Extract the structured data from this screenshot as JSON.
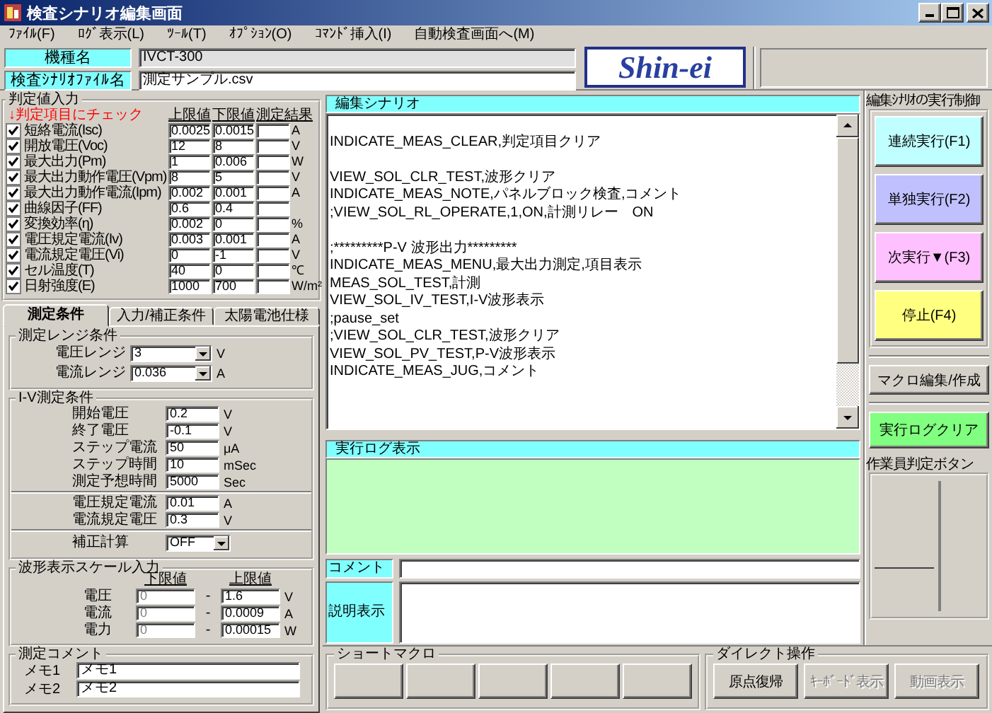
{
  "window": {
    "title": "検査シナリオ編集画面"
  },
  "menu": [
    {
      "label": "ﾌｧｲﾙ(F)"
    },
    {
      "label": "ﾛｸﾞ表示(L)"
    },
    {
      "label": "ﾂｰﾙ(T)"
    },
    {
      "label": "ｵﾌﾟｼｮﾝ(O)"
    },
    {
      "label": "ｺﾏﾝﾄﾞ挿入(I)"
    },
    {
      "label": "自動検査画面へ(M)"
    }
  ],
  "model": {
    "label": "機種名",
    "value": "IVCT-300",
    "readonly": true
  },
  "scenario_file": {
    "label": "検査ｼﾅﾘｵﾌｧｲﾙ名",
    "value": "測定サンプル.csv",
    "readonly": false
  },
  "logo": {
    "text": "Shin-ei"
  },
  "judgement": {
    "title": "判定値入力",
    "hint": "↓判定項目にチェック",
    "columns": [
      "上限値",
      "下限値",
      "測定結果"
    ],
    "rows": [
      {
        "name": "短絡電流(Isc)",
        "checked": true,
        "upper": "0.0025",
        "lower": "0.0015",
        "unit": "A"
      },
      {
        "name": "開放電圧(Voc)",
        "checked": true,
        "upper": "12",
        "lower": "8",
        "unit": "V"
      },
      {
        "name": "最大出力(Pm)",
        "checked": true,
        "upper": "1",
        "lower": "0.006",
        "unit": "W"
      },
      {
        "name": "最大出力動作電圧(Vpm)",
        "checked": true,
        "upper": "8",
        "lower": "5",
        "unit": "V"
      },
      {
        "name": "最大出力動作電流(Ipm)",
        "checked": true,
        "upper": "0.002",
        "lower": "0.001",
        "unit": "A"
      },
      {
        "name": "曲線因子(FF)",
        "checked": true,
        "upper": "0.6",
        "lower": "0.4"
      },
      {
        "name": "変換効率(η)",
        "checked": true,
        "upper": "0.002",
        "lower": "0",
        "unit": "%"
      },
      {
        "name": "電圧規定電流(Iv)",
        "checked": true,
        "upper": "0.003",
        "lower": "0.001",
        "unit": "A"
      },
      {
        "name": "電流規定電圧(Vi)",
        "checked": true,
        "upper": "0",
        "lower": "-1",
        "unit": "V"
      },
      {
        "name": "セル温度(T)",
        "checked": true,
        "upper": "40",
        "lower": "0",
        "unit": "℃"
      },
      {
        "name": "日射強度(E)",
        "checked": true,
        "upper": "1000",
        "lower": "700",
        "unit": "W/m²"
      }
    ]
  },
  "tabs": [
    {
      "label": "測定条件",
      "selected": true
    },
    {
      "label": "入力/補正条件",
      "selected": false
    },
    {
      "label": "太陽電池仕様",
      "selected": false
    }
  ],
  "range_conditions": {
    "title": "測定レンジ条件",
    "rows": [
      {
        "label": "電圧レンジ",
        "value": "3",
        "unit": "V"
      },
      {
        "label": "電流レンジ",
        "value": "0.036",
        "unit": "A"
      }
    ]
  },
  "iv_conditions": {
    "title": "I-V測定条件",
    "sections": [
      {
        "rows": [
          {
            "kind": "text",
            "label": "開始電圧",
            "value": "0.2",
            "unit": "V"
          },
          {
            "kind": "text",
            "label": "終了電圧",
            "value": "-0.1",
            "unit": "V"
          },
          {
            "kind": "text",
            "label": "ステップ電流",
            "value": "50",
            "unit": "μA"
          },
          {
            "kind": "text",
            "label": "ステップ時間",
            "value": "10",
            "unit": "mSec"
          },
          {
            "kind": "text",
            "label": "測定予想時間",
            "value": "5000",
            "unit": "Sec"
          }
        ]
      },
      {
        "rows": [
          {
            "kind": "text",
            "label": "電圧規定電流",
            "value": "0.01",
            "unit": "A"
          },
          {
            "kind": "text",
            "label": "電流規定電圧",
            "value": "0.3",
            "unit": "V"
          }
        ]
      },
      {
        "rows": [
          {
            "kind": "select",
            "label": "補正計算",
            "value": "OFF"
          }
        ]
      }
    ]
  },
  "scale": {
    "title": "波形表示スケール入力",
    "columns": [
      "下限値",
      "上限値"
    ],
    "rows": [
      {
        "label": "電圧",
        "lower": "0",
        "dash": "-",
        "upper": "1.6",
        "unit": "V"
      },
      {
        "label": "電流",
        "lower": "0",
        "dash": "-",
        "upper": "0.0009",
        "unit": "A"
      },
      {
        "label": "電力",
        "lower": "0",
        "dash": "-",
        "upper": "0.00015",
        "unit": "W"
      }
    ]
  },
  "measure_comment": {
    "title": "測定コメント",
    "rows": [
      {
        "label": "メモ1",
        "value": "メモ1"
      },
      {
        "label": "メモ2",
        "value": "メモ2"
      }
    ]
  },
  "editor": {
    "title": "編集シナリオ",
    "text": "\nINDICATE_MEAS_CLEAR,判定項目クリア\n\nVIEW_SOL_CLR_TEST,波形クリア\nINDICATE_MEAS_NOTE,パネルブロック検査,コメント\n;VIEW_SOL_RL_OPERATE,1,ON,計測リレー　ON\n\n;*********P-V 波形出力*********\nINDICATE_MEAS_MENU,最大出力測定,項目表示\nMEAS_SOL_TEST,計測\nVIEW_SOL_IV_TEST,I-V波形表示\n;pause_set\n;VIEW_SOL_CLR_TEST,波形クリア\nVIEW_SOL_PV_TEST,P-V波形表示\nINDICATE_MEAS_JUG,コメント"
  },
  "log": {
    "title": "実行ログ表示"
  },
  "comment": {
    "label": "コメント"
  },
  "description": {
    "label": "説明表示"
  },
  "control": {
    "title": "編集ｼﾅﾘｵの実行制御",
    "buttons": [
      {
        "label": "連続実行(F1)",
        "color": "#c0ffff"
      },
      {
        "label": "単独実行(F2)",
        "color": "#c0c0ff"
      },
      {
        "label": "次実行▼(F3)",
        "color": "#ffc0ff"
      },
      {
        "label": "停止(F4)",
        "color": "#ffff80"
      }
    ]
  },
  "macro_edit": {
    "label": "マクロ編集/作成"
  },
  "log_clear": {
    "label": "実行ログクリア"
  },
  "operator": {
    "title": "作業員判定ボタン"
  },
  "short_macro": {
    "title": "ショートマクロ",
    "buttons": [
      {
        "kind": "blank"
      },
      {
        "kind": "blank"
      },
      {
        "kind": "blank"
      },
      {
        "kind": "blank"
      },
      {
        "kind": "blank"
      }
    ]
  },
  "direct": {
    "title": "ダイレクト操作",
    "buttons": [
      {
        "label": "原点復帰",
        "disabled": false
      },
      {
        "label": "ｷｰﾎﾞｰﾄﾞ表示",
        "disabled": true
      },
      {
        "label": "動画表示",
        "disabled": true
      }
    ]
  }
}
